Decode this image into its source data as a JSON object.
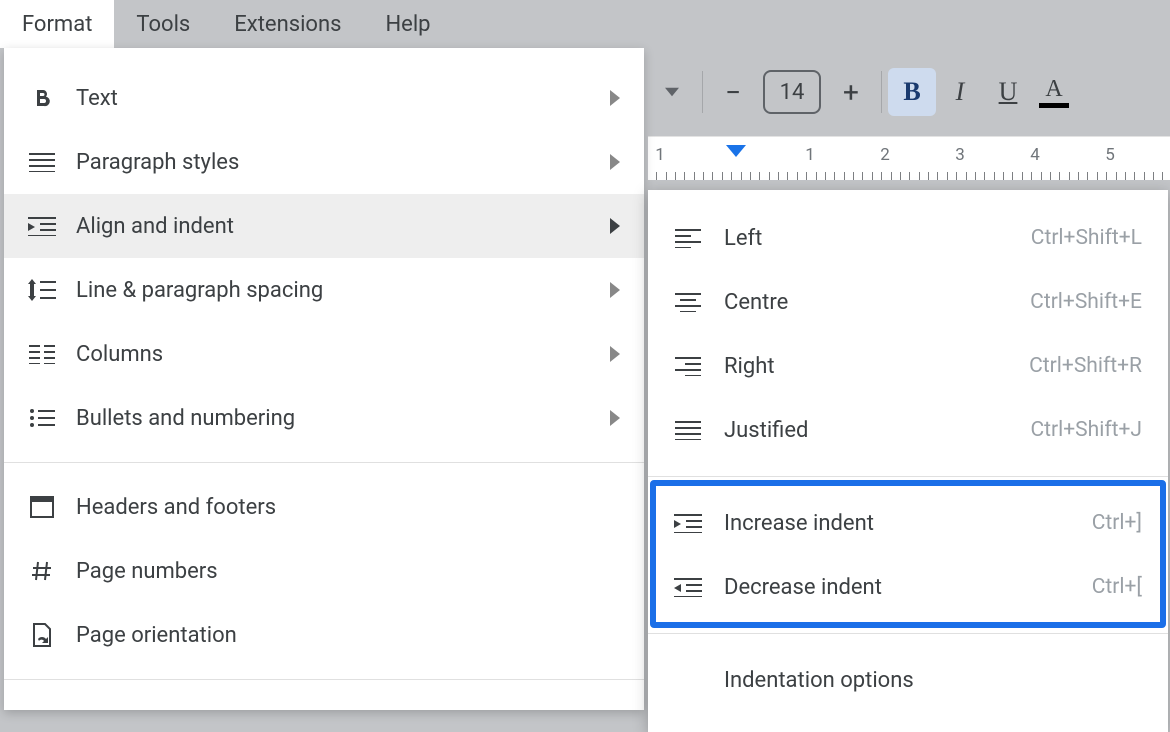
{
  "menubar": {
    "format": "Format",
    "tools": "Tools",
    "extensions": "Extensions",
    "help": "Help"
  },
  "toolbar": {
    "font_size": "14",
    "bold": "B",
    "italic": "I",
    "underline": "U",
    "text_color_glyph": "A"
  },
  "ruler": {
    "numbers": [
      "1",
      "1",
      "2",
      "3",
      "4",
      "5"
    ]
  },
  "format_menu": {
    "text": "Text",
    "paragraph_styles": "Paragraph styles",
    "align_and_indent": "Align and indent",
    "line_spacing": "Line & paragraph spacing",
    "columns": "Columns",
    "bullets_numbering": "Bullets and numbering",
    "headers_footers": "Headers and footers",
    "page_numbers": "Page numbers",
    "page_orientation": "Page orientation"
  },
  "align_submenu": {
    "left": {
      "label": "Left",
      "shortcut": "Ctrl+Shift+L"
    },
    "centre": {
      "label": "Centre",
      "shortcut": "Ctrl+Shift+E"
    },
    "right": {
      "label": "Right",
      "shortcut": "Ctrl+Shift+R"
    },
    "justified": {
      "label": "Justified",
      "shortcut": "Ctrl+Shift+J"
    },
    "increase_indent": {
      "label": "Increase indent",
      "shortcut": "Ctrl+]"
    },
    "decrease_indent": {
      "label": "Decrease indent",
      "shortcut": "Ctrl+["
    },
    "indentation_options": {
      "label": "Indentation options"
    }
  }
}
